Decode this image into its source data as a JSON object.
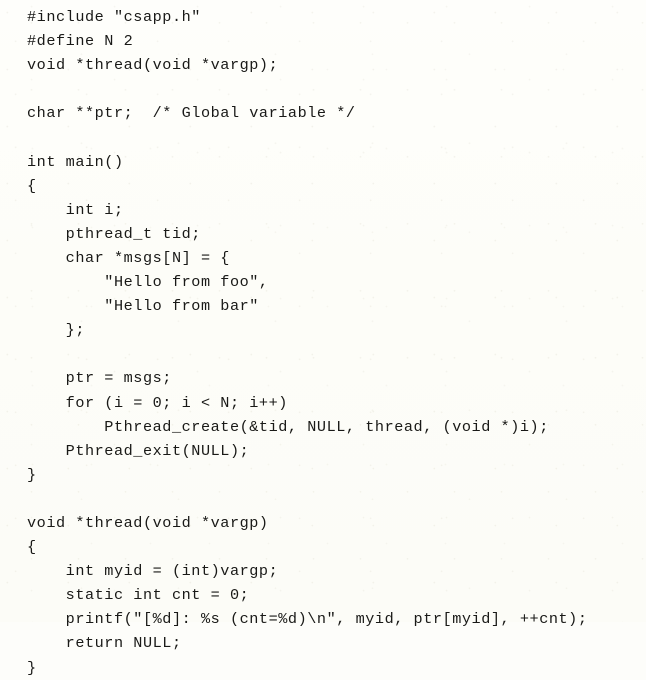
{
  "document": {
    "kind": "source-code-listing",
    "language": "C",
    "page_background": "#fdfdfa",
    "text_color": "#191917",
    "lines": [
      "#include \"csapp.h\"",
      "#define N 2",
      "void *thread(void *vargp);",
      "",
      "char **ptr;  /* Global variable */",
      "",
      "int main()",
      "{",
      "    int i;",
      "    pthread_t tid;",
      "    char *msgs[N] = {",
      "        \"Hello from foo\",",
      "        \"Hello from bar\"",
      "    };",
      "",
      "    ptr = msgs;",
      "    for (i = 0; i < N; i++)",
      "        Pthread_create(&tid, NULL, thread, (void *)i);",
      "    Pthread_exit(NULL);",
      "}",
      "",
      "void *thread(void *vargp)",
      "{",
      "    int myid = (int)vargp;",
      "    static int cnt = 0;",
      "    printf(\"[%d]: %s (cnt=%d)\\n\", myid, ptr[myid], ++cnt);",
      "    return NULL;",
      "}"
    ]
  }
}
